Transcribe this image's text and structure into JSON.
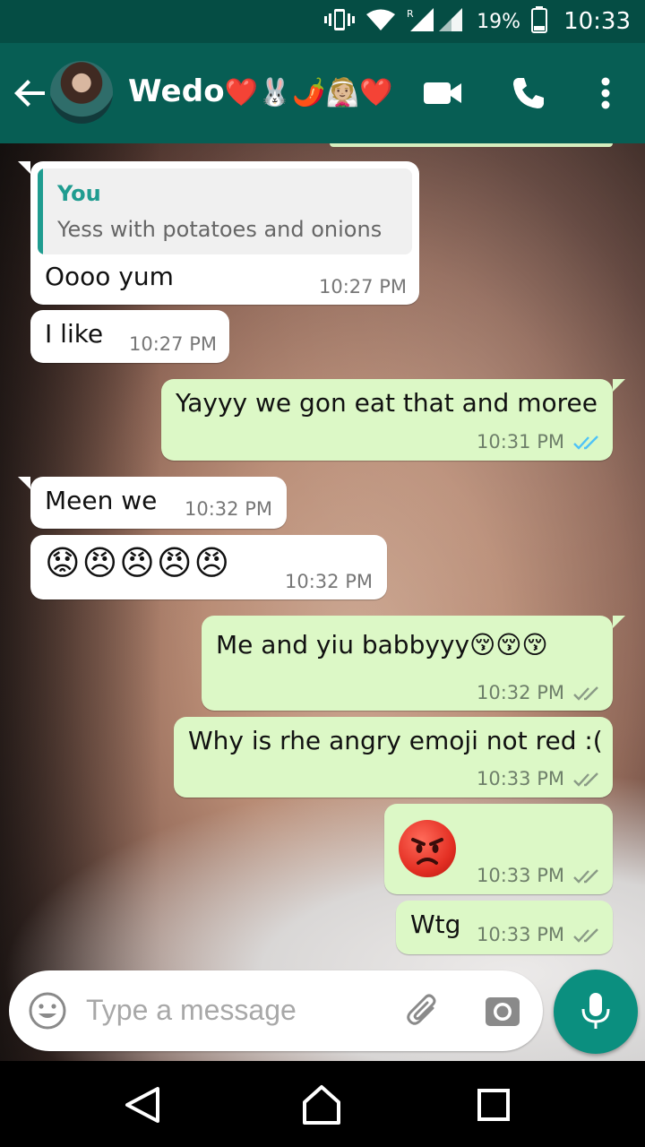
{
  "status_bar": {
    "battery_percent": "19%",
    "time": "10:33"
  },
  "header": {
    "contact_name": "Wedo",
    "name_emojis": "❤️🐰🌶️👰🏼❤️"
  },
  "messages": [
    {
      "direction": "incoming",
      "quote_author": "You",
      "quote_text": "Yess with potatoes and onions",
      "text": "Oooo yum",
      "time": "10:27 PM"
    },
    {
      "direction": "incoming",
      "text": "I like",
      "time": "10:27 PM"
    },
    {
      "direction": "outgoing",
      "text": "Yayyy we gon eat that and moree",
      "time": "10:31 PM",
      "status": "read"
    },
    {
      "direction": "incoming",
      "text": "Meen we",
      "time": "10:32 PM"
    },
    {
      "direction": "incoming",
      "text": "😟😠😠😠😠",
      "time": "10:32 PM"
    },
    {
      "direction": "outgoing",
      "text": "Me and yiu babbyyy😚😚😚",
      "time": "10:32 PM",
      "status": "delivered"
    },
    {
      "direction": "outgoing",
      "text": "Why is rhe angry emoji not red :(",
      "time": "10:33 PM",
      "status": "delivered"
    },
    {
      "direction": "outgoing",
      "text": "😡",
      "time": "10:33 PM",
      "status": "delivered"
    },
    {
      "direction": "outgoing",
      "text": "Wtg",
      "time": "10:33 PM",
      "status": "delivered"
    }
  ],
  "composer": {
    "placeholder": "Type a message"
  },
  "colors": {
    "header": "#075e54",
    "status_bar": "#054d44",
    "incoming_bubble": "#ffffff",
    "outgoing_bubble": "#dcf8c6",
    "read_ticks": "#4fc3f7",
    "delivered_ticks": "#8a9a86",
    "quote_accent": "#1f9c90",
    "mic_button": "#0b8f7f"
  },
  "icons": [
    "vibrate-icon",
    "wifi-icon",
    "signal-icon",
    "battery-icon",
    "back-arrow-icon",
    "video-call-icon",
    "phone-icon",
    "more-vert-icon",
    "emoji-icon",
    "attach-icon",
    "camera-icon",
    "mic-icon",
    "nav-back-icon",
    "nav-home-icon",
    "nav-recent-icon"
  ]
}
